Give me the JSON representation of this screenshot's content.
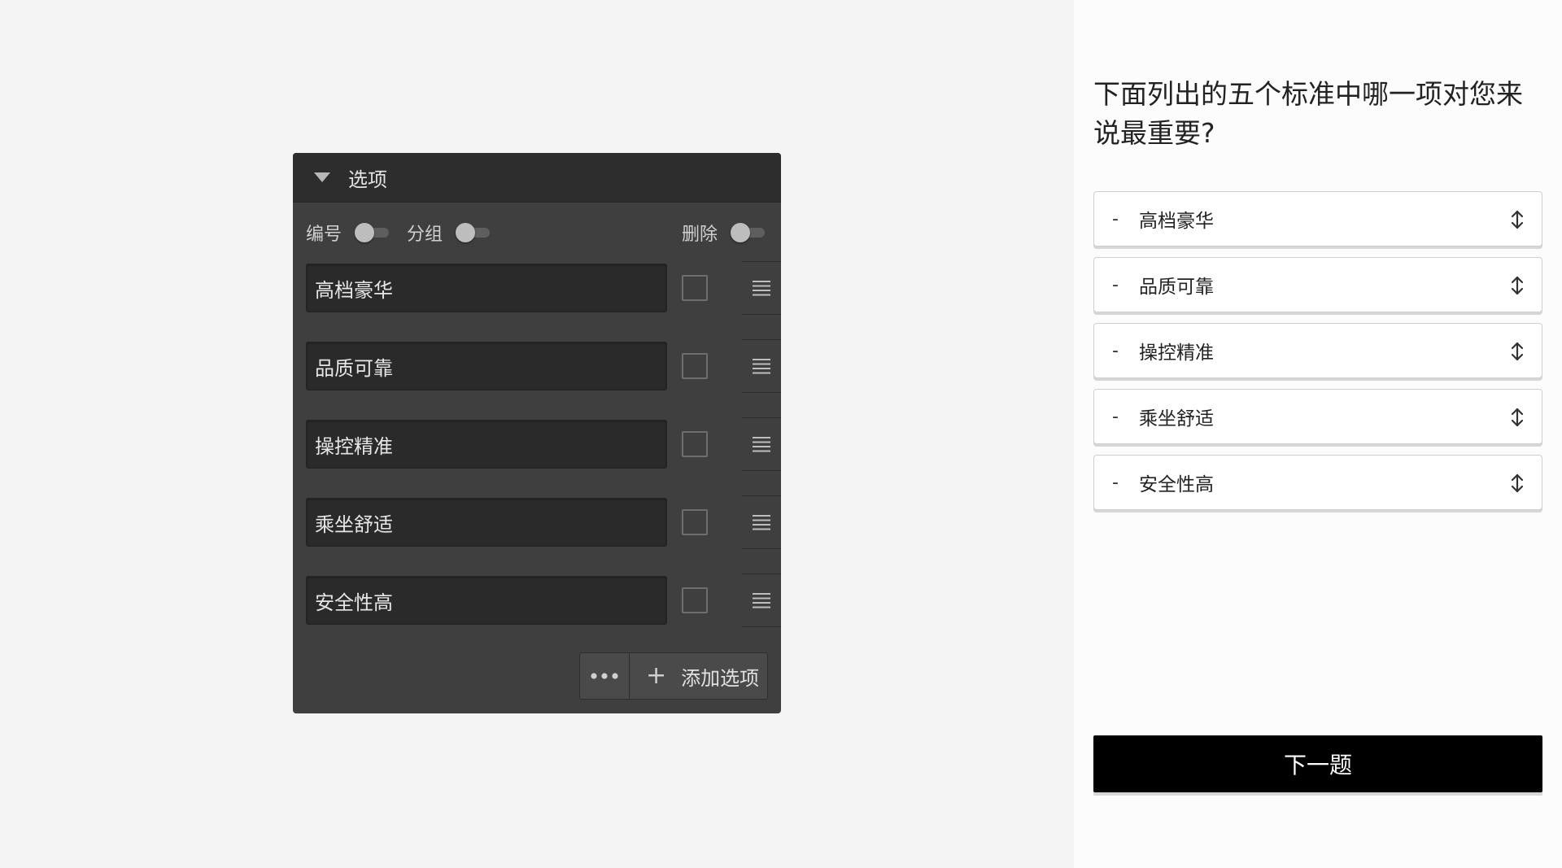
{
  "editor": {
    "title": "选项",
    "toggles": {
      "numbering_label": "编号",
      "grouping_label": "分组",
      "delete_label": "删除"
    },
    "options": [
      {
        "label": "高档豪华"
      },
      {
        "label": "品质可靠"
      },
      {
        "label": "操控精准"
      },
      {
        "label": "乘坐舒适"
      },
      {
        "label": "安全性高"
      }
    ],
    "add_option_label": "添加选项",
    "icons": {
      "collapse": "caret-down-icon",
      "drag": "drag-handle-icon",
      "more": "ellipsis-icon",
      "add": "plus-icon"
    }
  },
  "preview": {
    "question": "下面列出的五个标准中哪一项对您来说最重要?",
    "choices": [
      {
        "label": "高档豪华"
      },
      {
        "label": "品质可靠"
      },
      {
        "label": "操控精准"
      },
      {
        "label": "乘坐舒适"
      },
      {
        "label": "安全性高"
      }
    ],
    "dash": "-",
    "next_label": "下一题",
    "icons": {
      "sort": "sort-arrows-icon"
    }
  },
  "colors": {
    "page_bg": "#f4f4f4",
    "editor_bg": "#3f3f3f",
    "editor_header_bg": "#2d2d2d",
    "input_bg": "#2a2a2a",
    "preview_bg": "#fcfcfc",
    "next_button_bg": "#000000"
  }
}
